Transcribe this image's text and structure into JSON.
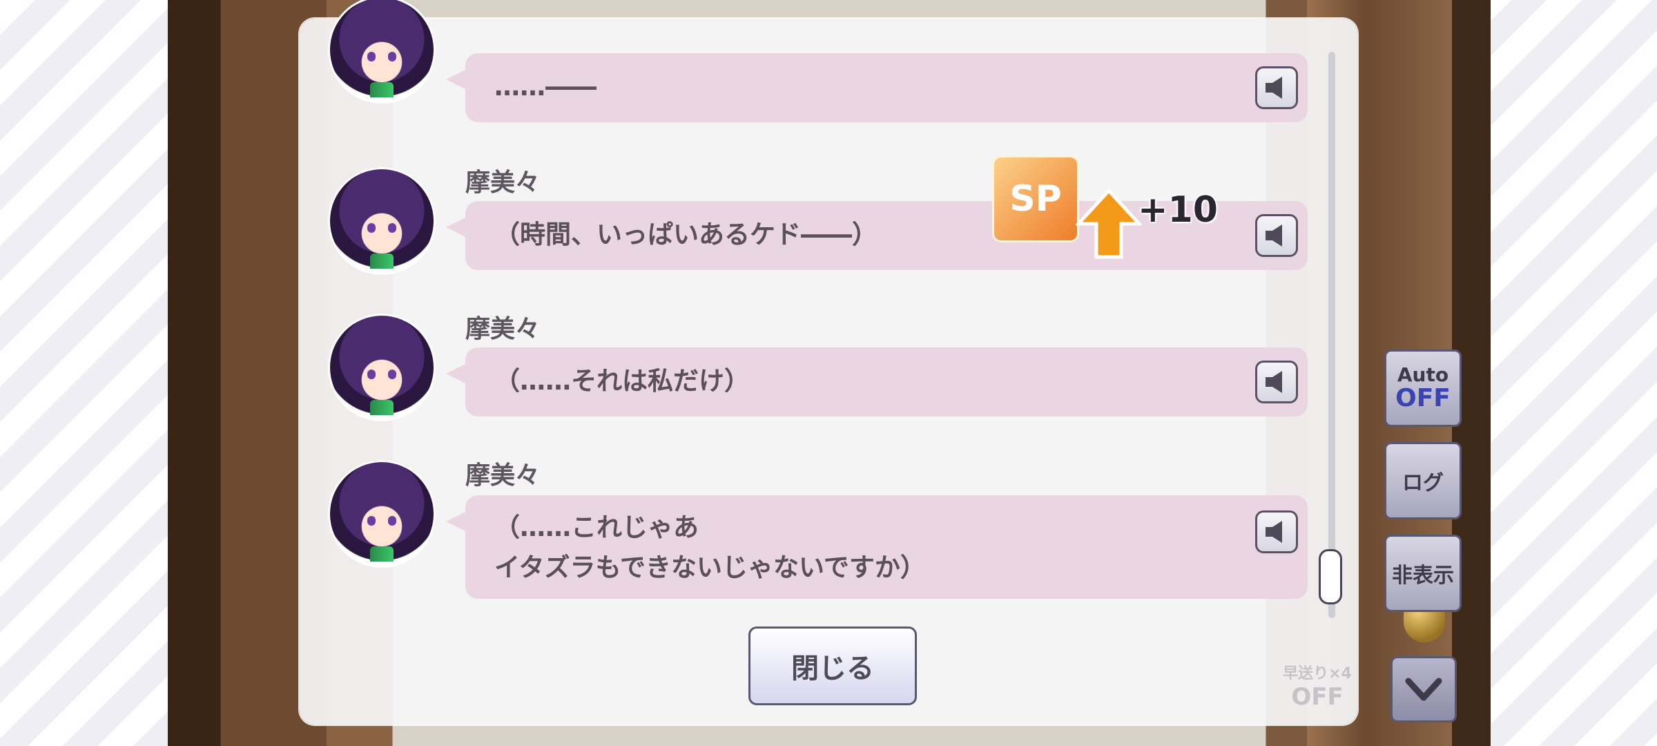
{
  "log": {
    "entries": [
      {
        "speaker": "",
        "text": "……――"
      },
      {
        "speaker": "摩美々",
        "text": "（時間、いっぱいあるケド――）"
      },
      {
        "speaker": "摩美々",
        "text": "（……それは私だけ）"
      },
      {
        "speaker": "摩美々",
        "text": "（……これじゃあ\nイタズラもできないじゃないですか）"
      }
    ],
    "close_label": "閉じる",
    "skip_toggle": {
      "label": "早送り×4",
      "state": "OFF"
    }
  },
  "reward": {
    "badge_label": "SP",
    "amount": "+10"
  },
  "side_controls": {
    "auto": {
      "label": "Auto",
      "state": "OFF"
    },
    "log_label": "ログ",
    "hide_label": "非表示"
  },
  "colors": {
    "bubble": "#ead6e2",
    "panel": "#f6f6f8",
    "accent": "#3a44b0",
    "arrow": "#f39a1a"
  }
}
